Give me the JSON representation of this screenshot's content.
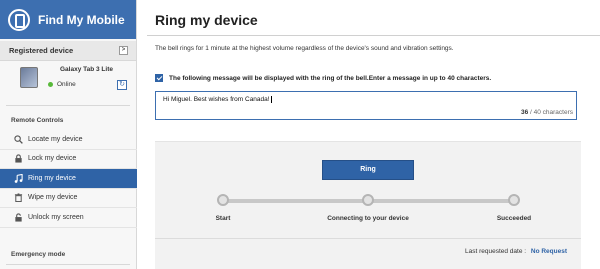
{
  "brand": {
    "title": "Find My Mobile",
    "icon": "find-my-mobile-logo-icon"
  },
  "sidebar": {
    "registered_heading": "Registered device",
    "expand_glyph": ">",
    "device": {
      "name": "Galaxy Tab 3 Lite",
      "status": "Online",
      "status_color": "#58b93a"
    },
    "remote_controls_label": "Remote Controls",
    "items": [
      {
        "label": "Locate my device",
        "icon": "magnifier-icon",
        "active": false
      },
      {
        "label": "Lock my device",
        "icon": "padlock-icon",
        "active": false
      },
      {
        "label": "Ring my device",
        "icon": "music-note-icon",
        "active": true
      },
      {
        "label": "Wipe my device",
        "icon": "trash-icon",
        "active": false
      },
      {
        "label": "Unlock my screen",
        "icon": "unlocked-padlock-icon",
        "active": false
      }
    ],
    "emergency_label": "Emergency mode"
  },
  "main": {
    "title": "Ring my device",
    "description": "The bell rings for 1 minute at the highest volume regardless of the device's sound and vibration settings.",
    "message_option_label": "The following message will be displayed with the ring of the bell.Enter a message in up to 40 characters.",
    "message_checked": true,
    "message_value": "Hi Miguel.  Best wishes from Canada!",
    "counter_current": "36",
    "counter_suffix": "/ 40 characters",
    "ring_button": "Ring",
    "steps": [
      "Start",
      "Connecting to your device",
      "Succeeded"
    ],
    "last_requested_label": "Last requested date :",
    "last_requested_value": "No Request"
  },
  "colors": {
    "accent": "#2f63a6",
    "brand": "#3d6fb0",
    "online": "#58b93a"
  }
}
